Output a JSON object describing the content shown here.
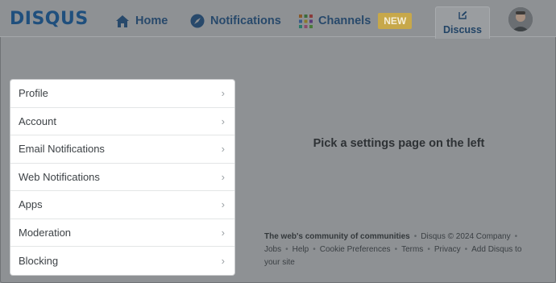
{
  "brand": {
    "logo_text": "DISQUS",
    "color": "#2e9fff"
  },
  "nav": {
    "home": {
      "label": "Home",
      "icon": "home-icon"
    },
    "notifications": {
      "label": "Notifications",
      "icon": "compass-icon"
    },
    "channels": {
      "label": "Channels",
      "icon": "grid-icon",
      "badge": "NEW"
    },
    "discuss": {
      "label": "Discuss",
      "icon": "edit-icon"
    },
    "avatar": {
      "icon": "user-avatar"
    }
  },
  "settings_menu": {
    "items": [
      {
        "label": "Profile"
      },
      {
        "label": "Account"
      },
      {
        "label": "Email Notifications"
      },
      {
        "label": "Web Notifications"
      },
      {
        "label": "Apps"
      },
      {
        "label": "Moderation"
      },
      {
        "label": "Blocking"
      }
    ],
    "chevron": "›"
  },
  "main": {
    "message": "Pick a settings page on the left"
  },
  "footer": {
    "tagline": "The web's community of communities",
    "copyright": "Disqus © 2024 Company",
    "links": [
      "Jobs",
      "Help",
      "Cookie Preferences",
      "Terms",
      "Privacy",
      "Add Disqus to your site"
    ],
    "separator": "•"
  },
  "colors": {
    "overlay": "#8e9194",
    "badge": "#c7a84a",
    "panel": "#ffffff"
  }
}
